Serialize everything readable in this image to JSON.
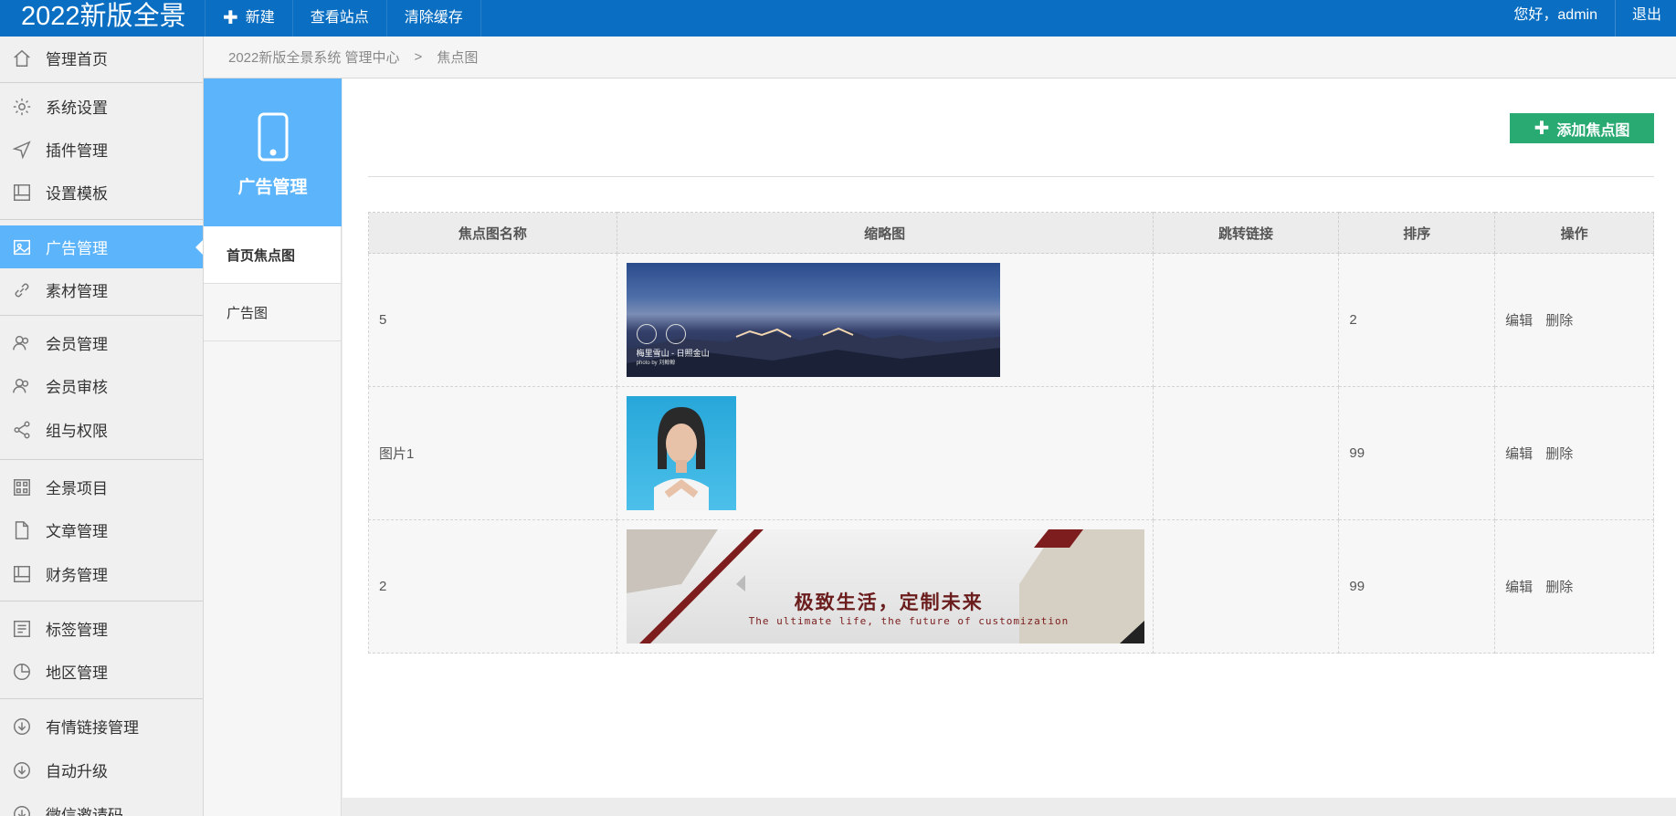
{
  "app": {
    "brand": "2022新版全景",
    "nav": {
      "new_label": "新建",
      "view_site": "查看站点",
      "clear_cache": "清除缓存"
    },
    "greeting": "您好，admin",
    "logout": "退出"
  },
  "sidebar": {
    "items": [
      {
        "label": "管理首页",
        "icon": "home-icon"
      },
      {
        "label": "系统设置",
        "icon": "gear-icon"
      },
      {
        "label": "插件管理",
        "icon": "send-icon"
      },
      {
        "label": "设置模板",
        "icon": "template-icon"
      },
      {
        "label": "广告管理",
        "icon": "image-icon",
        "active": true
      },
      {
        "label": "素材管理",
        "icon": "link-icon"
      },
      {
        "label": "会员管理",
        "icon": "users-icon"
      },
      {
        "label": "会员审核",
        "icon": "user-check-icon"
      },
      {
        "label": "组与权限",
        "icon": "share-icon"
      },
      {
        "label": "全景项目",
        "icon": "grid-icon"
      },
      {
        "label": "文章管理",
        "icon": "file-icon"
      },
      {
        "label": "财务管理",
        "icon": "book-icon"
      },
      {
        "label": "标签管理",
        "icon": "list-icon"
      },
      {
        "label": "地区管理",
        "icon": "pie-icon"
      },
      {
        "label": "有情链接管理",
        "icon": "download-circle-icon"
      },
      {
        "label": "自动升级",
        "icon": "download-circle-icon"
      },
      {
        "label": "微信邀请码",
        "icon": "download-circle-icon"
      }
    ]
  },
  "breadcrumb": {
    "root": "2022新版全景系统 管理中心",
    "sep": ">",
    "current": "焦点图"
  },
  "subpanel": {
    "title": "广告管理",
    "items": [
      {
        "label": "首页焦点图",
        "active": true
      },
      {
        "label": "广告图"
      }
    ]
  },
  "main": {
    "add_button": "添加焦点图",
    "table": {
      "headers": [
        "焦点图名称",
        "缩略图",
        "跳转链接",
        "排序",
        "操作"
      ],
      "rows": [
        {
          "name": "5",
          "thumb": "mountain-banner",
          "link": "",
          "order": "2",
          "edit": "编辑",
          "delete": "删除"
        },
        {
          "name": "图片1",
          "thumb": "avatar-girl",
          "link": "",
          "order": "99",
          "edit": "编辑",
          "delete": "删除"
        },
        {
          "name": "2",
          "thumb": "home-banner",
          "link": "",
          "order": "99",
          "edit": "编辑",
          "delete": "删除"
        }
      ]
    },
    "thumb_texts": {
      "mountain_caption": "梅里雪山 - 日照金山",
      "mountain_credit": "photo by 刘鲸鲸",
      "home_headline": "极致生活，定制未来",
      "home_sub": "The ultimate life, the future of customization"
    }
  },
  "colors": {
    "topbar": "#0a6fc2",
    "accent": "#5cb4fb",
    "add_button": "#2aaa73"
  }
}
